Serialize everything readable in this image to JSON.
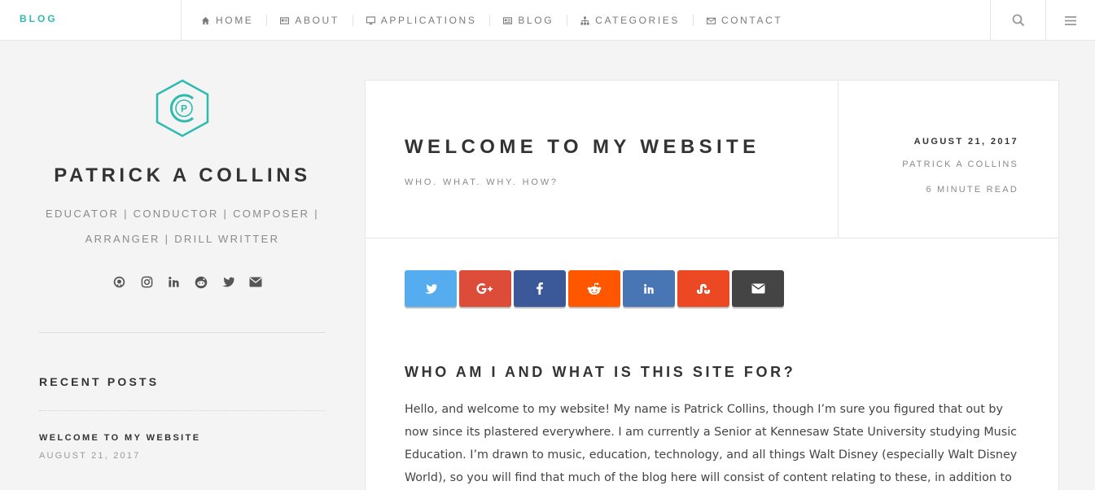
{
  "header": {
    "brand": "BLOG",
    "nav": [
      {
        "label": "HOME",
        "icon": "home-icon"
      },
      {
        "label": "ABOUT",
        "icon": "id-card-icon"
      },
      {
        "label": "APPLICATIONS",
        "icon": "desktop-icon"
      },
      {
        "label": "BLOG",
        "icon": "newspaper-icon"
      },
      {
        "label": "CATEGORIES",
        "icon": "sitemap-icon"
      },
      {
        "label": "CONTACT",
        "icon": "envelope-icon"
      }
    ],
    "search_icon": "search-icon",
    "menu_icon": "hamburger-menu-icon"
  },
  "sidebar": {
    "logo_letter": "P",
    "name": "PATRICK A COLLINS",
    "bio_line1": "EDUCATOR | CONDUCTOR | COMPOSER |",
    "bio_line2": "ARRANGER | DRILL WRITTER",
    "socials": [
      "github-icon",
      "instagram-icon",
      "linkedin-icon",
      "reddit-icon",
      "twitter-icon",
      "email-icon"
    ],
    "recent_posts_title": "RECENT POSTS",
    "recent_posts": [
      {
        "title": "WELCOME TO MY WEBSITE",
        "date": "AUGUST 21, 2017"
      }
    ]
  },
  "article": {
    "title": "WELCOME TO MY WEBSITE",
    "subtitle": "WHO. WHAT. WHY. HOW?",
    "date": "AUGUST 21, 2017",
    "author": "PATRICK A COLLINS",
    "read_time": "6 MINUTE READ",
    "share": [
      {
        "name": "twitter",
        "color": "#55acee",
        "icon": "twitter-icon"
      },
      {
        "name": "google-plus",
        "color": "#dd4b39",
        "icon": "google-plus-icon"
      },
      {
        "name": "facebook",
        "color": "#3b5998",
        "icon": "facebook-icon"
      },
      {
        "name": "reddit",
        "color": "#ff5700",
        "icon": "reddit-icon"
      },
      {
        "name": "linkedin",
        "color": "#4875b4",
        "icon": "linkedin-icon"
      },
      {
        "name": "stumbleupon",
        "color": "#eb4823",
        "icon": "stumbleupon-icon"
      },
      {
        "name": "email",
        "color": "#444444",
        "icon": "envelope-icon"
      }
    ],
    "heading": "WHO AM I AND WHAT IS THIS SITE FOR?",
    "paragraph": "Hello, and welcome to my website! My name is Patrick Collins, though I’m sure you figured that out by now since its plastered everywhere. I am currently a Senior at Kennesaw State University studying Music Education. I’m drawn to music, education, technology, and all things Walt Disney (especially Walt Disney World), so you will find that much of the blog here will consist of content relating to these, in addition to some eclectic sprinklings"
  },
  "colors": {
    "accent": "#2ebaae",
    "background": "#f4f4f4",
    "text": "#333333"
  }
}
